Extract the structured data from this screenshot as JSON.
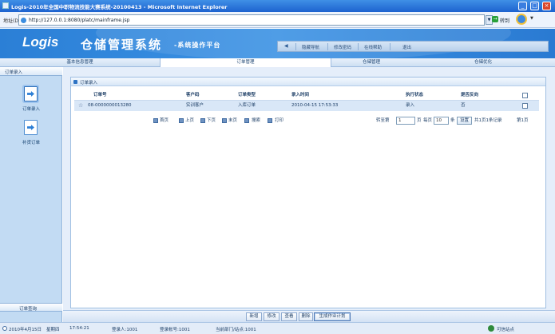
{
  "window": {
    "title": "Logis-2010年全国中职物流技能大赛系统-20100413 - Microsoft Internet Explorer",
    "minimize": "_",
    "restore": "□",
    "close": "×"
  },
  "addressbar": {
    "label": "地址(D)",
    "url": "http://127.0.0.1:8080/platc/mainframe.jsp",
    "go_label": "转到"
  },
  "banner": {
    "logo": "Logis",
    "system_name": "仓储管理系统",
    "subtitle": "-系统操作平台",
    "tools": [
      "隐藏导航",
      "修改密码",
      "在线帮助",
      "退出"
    ],
    "back_arrow": "◀"
  },
  "module_tabs": [
    "基本信息管理",
    "订单管理",
    "仓储管理",
    "仓储优化"
  ],
  "active_module": 1,
  "sidebar": {
    "header": "订单录入",
    "items": [
      {
        "label": "订单录入",
        "icon": "order-entry-icon"
      },
      {
        "label": "补货订单",
        "icon": "replenish-order-icon"
      }
    ],
    "footer": "订单查询"
  },
  "panel": {
    "title": "订单录入"
  },
  "table": {
    "columns": [
      "订单号",
      "客户码",
      "订单类型",
      "录入时间",
      "执行状态",
      "是否反向"
    ],
    "rows": [
      {
        "order_no": "08-0000000013280",
        "customer": "实训客户",
        "type": "入库订单",
        "time": "2010-04-15 17:53:33",
        "status": "录入",
        "reverse": "否",
        "row_icon": "☆"
      }
    ]
  },
  "pager": {
    "first": "首页",
    "prev": "上页",
    "next": "下页",
    "last": "末页",
    "search": "搜索",
    "print": "打印",
    "goto_label": "转至第",
    "goto_value": "1",
    "page_unit": "页",
    "per_page_label": "每页",
    "per_page_value": "10",
    "per_page_unit": "条",
    "apply": "设置",
    "summary": "共1页1条记录",
    "current": "第1页"
  },
  "actions": [
    "新增",
    "修改",
    "查看",
    "删除",
    "生成作业计划"
  ],
  "statusbar": {
    "date": "2010年4月15日",
    "weekday": "星期四",
    "time": "17:54:21",
    "login_user": "登录人:1001",
    "account": "登录帐号:1001",
    "dept": "当前部门/站点:1001",
    "zone": "可信站点"
  },
  "colors": {
    "banner": "#2b7fd6",
    "sidebar": "#c2dbf3",
    "selected_row": "#d9e7f7",
    "text": "#1e3f67"
  }
}
